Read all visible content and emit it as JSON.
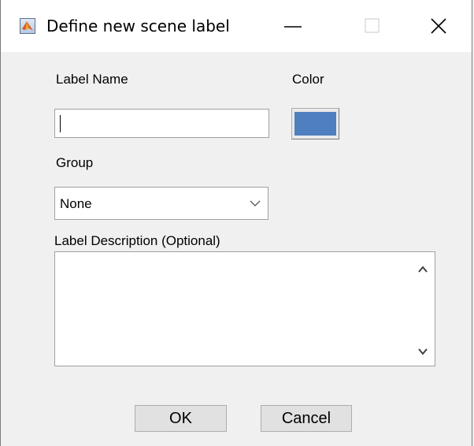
{
  "window": {
    "title": "Define new scene label",
    "icon": "matlab-icon",
    "controls": [
      "minimize-icon",
      "maximize-icon",
      "close-icon"
    ]
  },
  "form": {
    "label_name": {
      "label": "Label Name",
      "value": "",
      "placeholder": ""
    },
    "color": {
      "label": "Color",
      "value": "#4f7fbf"
    },
    "group": {
      "label": "Group",
      "selected": "None"
    },
    "description": {
      "label": "Label Description (Optional)",
      "value": ""
    }
  },
  "buttons": {
    "ok": "OK",
    "cancel": "Cancel"
  }
}
